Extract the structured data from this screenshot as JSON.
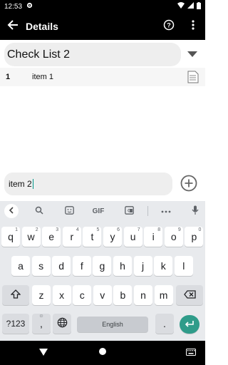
{
  "status": {
    "time": "12:53",
    "gear_icon": "gear-icon",
    "wifi_icon": "wifi-icon",
    "signal_icon": "signal-icon",
    "battery_icon": "battery-icon"
  },
  "appbar": {
    "title": "Details",
    "back_icon": "arrow-back-icon",
    "help_icon": "help-circle-icon",
    "menu_icon": "more-vert-icon"
  },
  "list": {
    "selected": "Check List 2"
  },
  "items": [
    {
      "num": "1",
      "text": "item 1"
    }
  ],
  "input": {
    "value": "item 2"
  },
  "keyboard": {
    "toolbar": {
      "gif": "GIF"
    },
    "row1": [
      "q",
      "w",
      "e",
      "r",
      "t",
      "y",
      "u",
      "i",
      "o",
      "p"
    ],
    "row1_hints": [
      "1",
      "2",
      "3",
      "4",
      "5",
      "6",
      "7",
      "8",
      "9",
      "0"
    ],
    "row2": [
      "a",
      "s",
      "d",
      "f",
      "g",
      "h",
      "j",
      "k",
      "l"
    ],
    "row3": [
      "z",
      "x",
      "c",
      "v",
      "b",
      "n",
      "m"
    ],
    "num_label": "?123",
    "comma": ",",
    "period": ".",
    "space_label": "English"
  },
  "colors": {
    "accent": "#2f9c8a",
    "bar": "#000000"
  }
}
